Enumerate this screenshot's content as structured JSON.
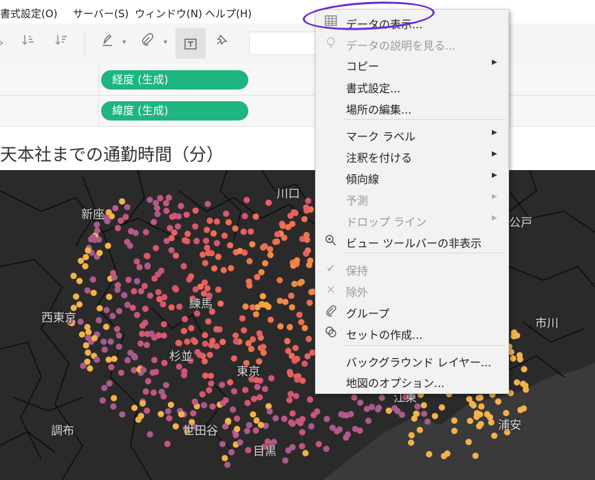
{
  "menubar": {
    "items": [
      "書式設定(O)",
      "サーバー(S)",
      "ウィンドウ(N)",
      "ヘルプ(H)"
    ]
  },
  "shelves": {
    "columns_pill": "経度 (生成)",
    "rows_pill": "緯度 (生成)"
  },
  "viz": {
    "title": "天本社までの通勤時間（分）"
  },
  "map": {
    "places": [
      "川口",
      "新座",
      "西東京",
      "練馬",
      "杉並",
      "東京",
      "世田谷",
      "調布",
      "市川",
      "公戸",
      "浦安",
      "江東",
      "目黒"
    ]
  },
  "context_menu": {
    "items": [
      {
        "label": "データの表示...",
        "icon": "table-icon"
      },
      {
        "label": "データの説明を見る...",
        "icon": "lightbulb-icon"
      },
      {
        "label": "コピー",
        "icon": ""
      },
      {
        "label": "書式設定...",
        "icon": ""
      },
      {
        "label": "場所の編集...",
        "icon": ""
      },
      {
        "label": "マーク ラベル",
        "icon": ""
      },
      {
        "label": "注釈を付ける",
        "icon": ""
      },
      {
        "label": "傾向線",
        "icon": ""
      },
      {
        "label": "予測",
        "icon": ""
      },
      {
        "label": "ドロップ ライン",
        "icon": ""
      },
      {
        "label": "ビュー ツールバーの非表示",
        "icon": "zoom-icon"
      },
      {
        "label": "保持",
        "icon": "check-icon"
      },
      {
        "label": "除外",
        "icon": "x-icon"
      },
      {
        "label": "グループ",
        "icon": "paperclip-icon"
      },
      {
        "label": "セットの作成...",
        "icon": "set-icon"
      },
      {
        "label": "バックグラウンド レイヤー...",
        "icon": ""
      },
      {
        "label": "地図のオプション...",
        "icon": ""
      }
    ]
  },
  "colors": {
    "pill": "#1fb57e",
    "map_bg": "#2a2a2a",
    "annotation": "#6a2ad0"
  }
}
